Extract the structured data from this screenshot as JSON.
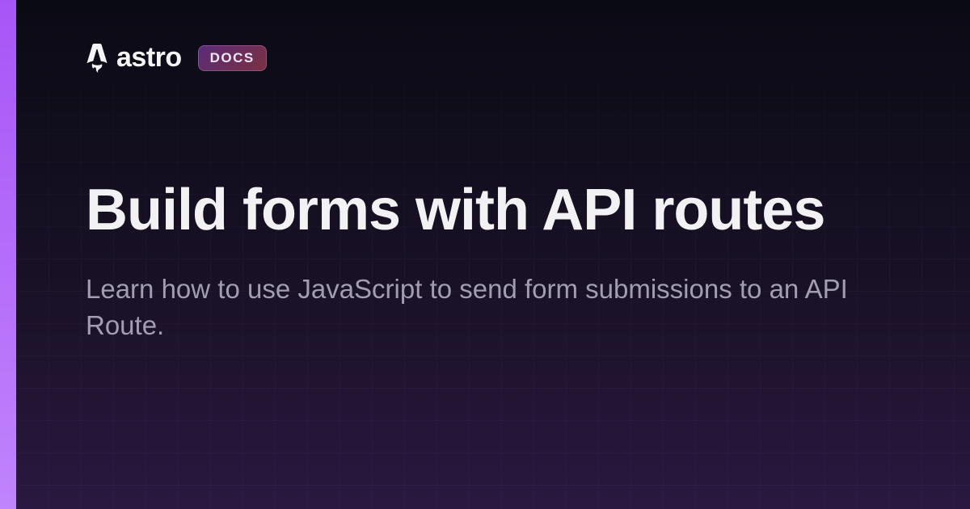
{
  "header": {
    "brand": "astro",
    "badge": "DOCS"
  },
  "content": {
    "title": "Build forms with API routes",
    "subtitle": "Learn how to use JavaScript to send form submissions to an API Route."
  }
}
